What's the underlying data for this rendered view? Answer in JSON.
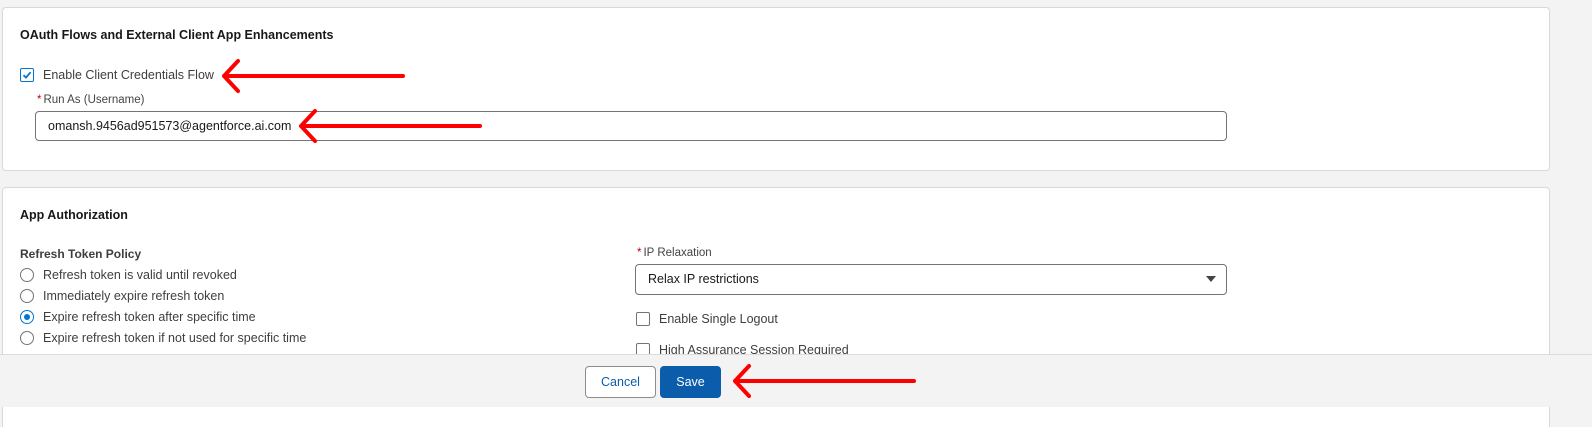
{
  "oauth_section": {
    "title": "OAuth Flows and External Client App Enhancements",
    "client_credentials": {
      "label": "Enable Client Credentials Flow",
      "checked": true
    },
    "run_as": {
      "required_marker": "*",
      "label": "Run As (Username)",
      "value": "omansh.9456ad951573@agentforce.ai.com"
    }
  },
  "auth_section": {
    "title": "App Authorization",
    "refresh_policy": {
      "label": "Refresh Token Policy",
      "options": [
        {
          "label": "Refresh token is valid until revoked",
          "selected": false
        },
        {
          "label": "Immediately expire refresh token",
          "selected": false
        },
        {
          "label": "Expire refresh token after specific time",
          "selected": true
        },
        {
          "label": "Expire refresh token if not used for specific time",
          "selected": false
        }
      ]
    },
    "ip_relaxation": {
      "required_marker": "*",
      "label": "IP Relaxation",
      "value": "Relax IP restrictions"
    },
    "single_logout": {
      "label": "Enable Single Logout",
      "checked": false
    },
    "high_assurance": {
      "label": "High Assurance Session Required",
      "checked": false
    }
  },
  "footer": {
    "cancel_label": "Cancel",
    "save_label": "Save"
  },
  "colors": {
    "brand": "#0b5cab",
    "annotation_arrow": "#ff0000",
    "required": "#ba0517"
  },
  "annotations": [
    "red-arrow",
    "red-arrow",
    "red-arrow"
  ]
}
